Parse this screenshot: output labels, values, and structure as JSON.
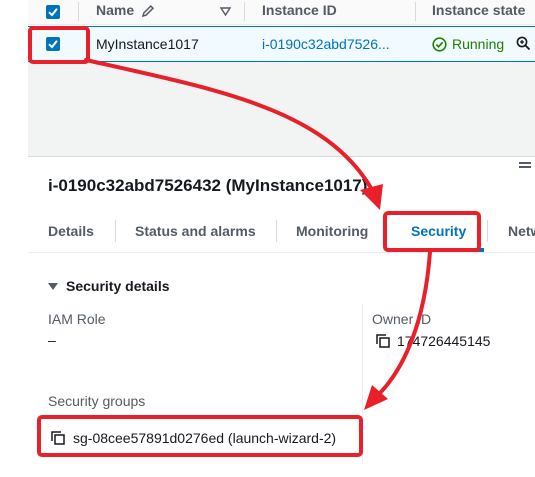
{
  "table": {
    "columns": {
      "name": "Name",
      "instance_id": "Instance ID",
      "instance_state": "Instance state"
    },
    "row": {
      "name": "MyInstance1017",
      "instance_id": "i-0190c32abd7526...",
      "state": "Running"
    }
  },
  "details": {
    "title": "i-0190c32abd7526432 (MyInstance1017)",
    "tabs": [
      "Details",
      "Status and alarms",
      "Monitoring",
      "Security",
      "Netw"
    ],
    "active_tab": "Security",
    "section_title": "Security details",
    "iam_role_label": "IAM Role",
    "iam_role_value": "–",
    "owner_id_label": "Owner ID",
    "owner_id_value": "174726445145",
    "security_groups_label": "Security groups",
    "security_group_link": "sg-08cee57891d0276ed (launch-wizard-2)"
  },
  "colors": {
    "accent": "#0073bb",
    "running": "#1d8102",
    "annotation": "#e8202a"
  },
  "icons": [
    "checkbox-icon",
    "edit-pencil-icon",
    "sort-caret-icon",
    "running-check-icon",
    "zoom-icon",
    "resize-handle-icon",
    "expand-caret-icon",
    "copy-icon"
  ]
}
